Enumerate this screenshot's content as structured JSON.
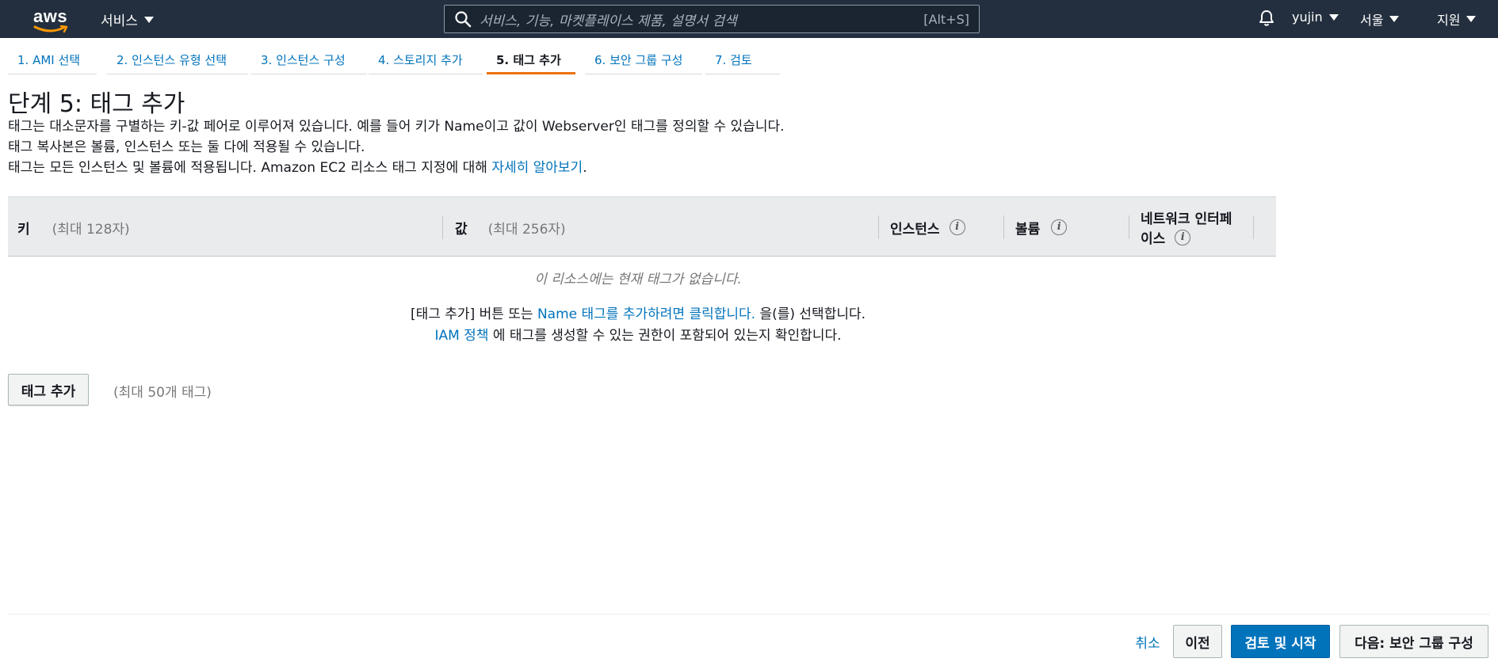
{
  "nav": {
    "logo_text": "aws",
    "services_label": "서비스",
    "search_placeholder": "서비스, 기능, 마켓플레이스 제품, 설명서 검색",
    "search_shortcut": "[Alt+S]",
    "user_label": "yujin",
    "region_label": "서울",
    "support_label": "지원"
  },
  "wizard": {
    "steps": [
      {
        "label": "1. AMI 선택"
      },
      {
        "label": "2. 인스턴스 유형 선택"
      },
      {
        "label": "3. 인스턴스 구성"
      },
      {
        "label": "4. 스토리지 추가"
      },
      {
        "label": "5. 태그 추가"
      },
      {
        "label": "6. 보안 그룹 구성"
      },
      {
        "label": "7. 검토"
      }
    ],
    "active_step": 5
  },
  "page": {
    "title": "단계 5: 태그 추가",
    "desc_line1": "태그는 대소문자를 구별하는 키-값 페어로 이루어져 있습니다. 예를 들어 키가 Name이고 값이 Webserver인 태그를 정의할 수 있습니다.",
    "desc_line2": "태그 복사본은 볼륨, 인스턴스 또는 둘 다에 적용될 수 있습니다.",
    "desc_line3_prefix": "태그는 모든 인스턴스 및 볼륨에 적용됩니다. Amazon EC2 리소스 태그 지정에 대해 ",
    "desc_line3_link": "자세히 알아보기",
    "desc_line3_suffix": "."
  },
  "table": {
    "col_key": "키",
    "col_key_hint": "(최대 128자)",
    "col_value": "값",
    "col_value_hint": "(최대 256자)",
    "col_instances": "인스턴스",
    "col_volumes": "볼륨",
    "col_network_line1": "네트워크 인터페",
    "col_network_line2": "이스",
    "empty_message": "이 리소스에는 현재 태그가 없습니다.",
    "help_prefix": "[태그 추가] 버튼 또는 ",
    "help_link": "Name 태그를 추가하려면 클릭합니다.",
    "help_suffix": " 을(를) 선택합니다.",
    "iam_link": "IAM 정책",
    "iam_suffix": " 에 태그를 생성할 수 있는 권한이 포함되어 있는지 확인합니다."
  },
  "actions": {
    "add_tag_label": "태그 추가",
    "max_tags_text": "(최대 50개 태그)",
    "cancel_label": "취소",
    "previous_label": "이전",
    "review_launch_label": "검토 및 시작",
    "next_label": "다음: 보안 그룹 구성"
  }
}
